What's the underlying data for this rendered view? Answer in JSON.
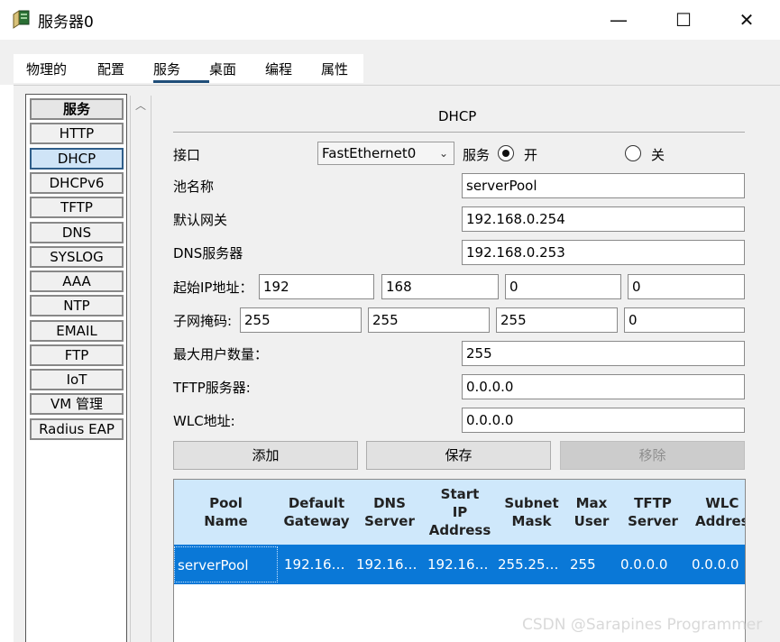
{
  "window": {
    "title": "服务器0",
    "minimize_glyph": "—",
    "maximize_glyph": "☐",
    "close_glyph": "✕"
  },
  "tabs": [
    {
      "label": "物理的",
      "active": false
    },
    {
      "label": "配置",
      "active": false
    },
    {
      "label": "服务",
      "active": true
    },
    {
      "label": "桌面",
      "active": false
    },
    {
      "label": "编程",
      "active": false
    },
    {
      "label": "属性",
      "active": false
    }
  ],
  "sidebar": {
    "header": "服务",
    "items": [
      {
        "label": "HTTP",
        "selected": false
      },
      {
        "label": "DHCP",
        "selected": true
      },
      {
        "label": "DHCPv6",
        "selected": false
      },
      {
        "label": "TFTP",
        "selected": false
      },
      {
        "label": "DNS",
        "selected": false
      },
      {
        "label": "SYSLOG",
        "selected": false
      },
      {
        "label": "AAA",
        "selected": false
      },
      {
        "label": "NTP",
        "selected": false
      },
      {
        "label": "EMAIL",
        "selected": false
      },
      {
        "label": "FTP",
        "selected": false
      },
      {
        "label": "IoT",
        "selected": false
      },
      {
        "label": "VM 管理",
        "selected": false
      },
      {
        "label": "Radius EAP",
        "selected": false
      }
    ],
    "scroll_up_glyph": "︿"
  },
  "dhcp": {
    "section_title": "DHCP",
    "interface_label": "接口",
    "interface_value": "FastEthernet0",
    "service_label": "服务",
    "service_on_label": "开",
    "service_off_label": "关",
    "service_on": true,
    "pool_name_label": "池名称",
    "pool_name_value": "serverPool",
    "gateway_label": "默认网关",
    "gateway_value": "192.168.0.254",
    "dns_label": "DNS服务器",
    "dns_value": "192.168.0.253",
    "start_ip_label": "起始IP地址：",
    "start_ip": [
      "192",
      "168",
      "0",
      "0"
    ],
    "subnet_label": "子网掩码:",
    "subnet": [
      "255",
      "255",
      "255",
      "0"
    ],
    "max_users_label": "最大用户数量：",
    "max_users_value": "255",
    "tftp_label": "TFTP服务器:",
    "tftp_value": "0.0.0.0",
    "wlc_label": "WLC地址:",
    "wlc_value": "0.0.0.0",
    "add_button": "添加",
    "save_button": "保存",
    "remove_button": "移除"
  },
  "table": {
    "columns": [
      "Pool\nName",
      "Default\nGateway",
      "DNS\nServer",
      "Start\nIP\nAddress",
      "Subnet\nMask",
      "Max\nUser",
      "TFTP\nServer",
      "WLC\nAddres"
    ],
    "rows": [
      [
        "serverPool",
        "192.16…",
        "192.16…",
        "192.16…",
        "255.25…",
        "255",
        "0.0.0.0",
        "0.0.0.0"
      ]
    ]
  },
  "watermark": "CSDN @Sarapines Programmer"
}
